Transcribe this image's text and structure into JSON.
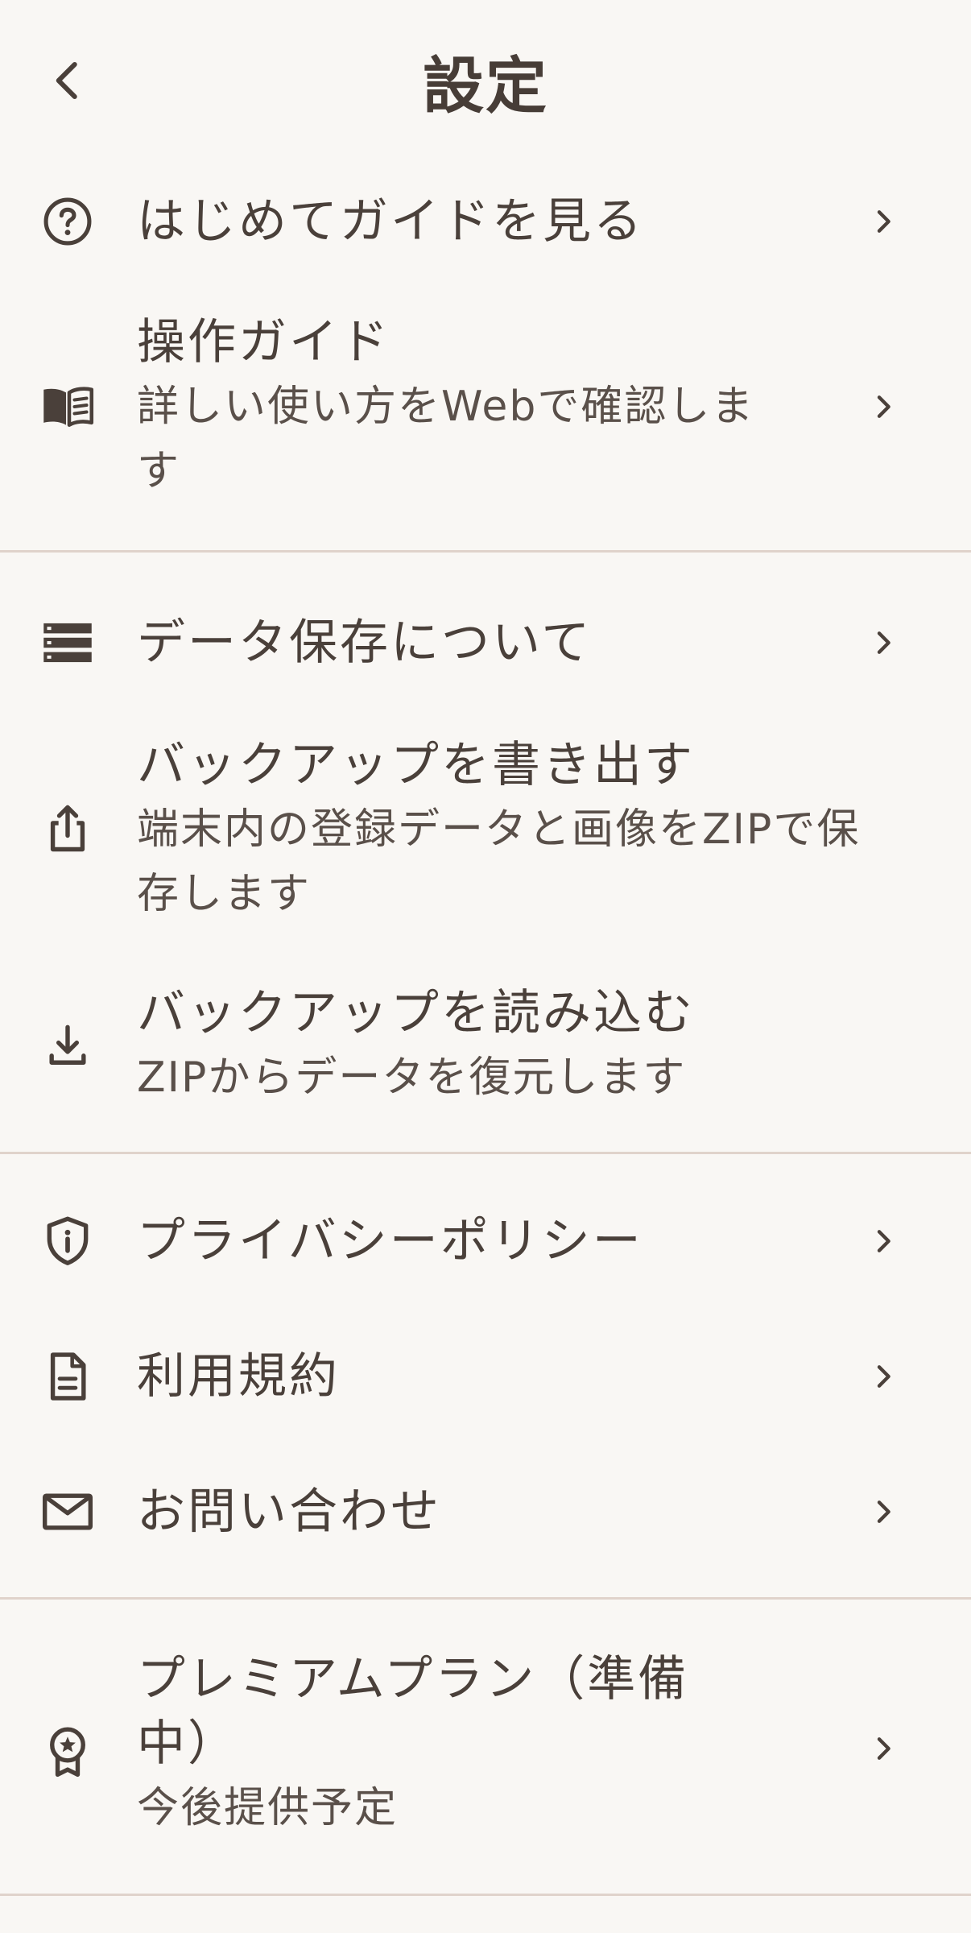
{
  "header": {
    "title": "設定",
    "back_icon": "chevron-left-icon"
  },
  "items": {
    "guide_start": {
      "title": "はじめてガイドを見る",
      "icon": "help-circle-icon"
    },
    "operation_guide": {
      "title": "操作ガイド",
      "subtitle_line1": "詳しい使い方をWebで確認しま",
      "subtitle_line2": "す",
      "icon": "book-open-icon"
    },
    "data_storage": {
      "title": "データ保存について",
      "icon": "storage-icon"
    },
    "export_backup": {
      "title": "バックアップを書き出す",
      "subtitle_line1": "端末内の登録データと画像をZIPで保",
      "subtitle_line2": "存します",
      "icon": "share-upload-icon"
    },
    "import_backup": {
      "title": "バックアップを読み込む",
      "subtitle_line1": "ZIPからデータを復元します",
      "icon": "download-icon"
    },
    "privacy": {
      "title": "プライバシーポリシー",
      "icon": "shield-info-icon"
    },
    "terms": {
      "title": "利用規約",
      "icon": "document-icon"
    },
    "contact": {
      "title": "お問い合わせ",
      "icon": "mail-icon"
    },
    "premium": {
      "title_line1": "プレミアムプラン（準備",
      "title_line2": "中）",
      "subtitle_line1": "今後提供予定",
      "icon": "award-star-icon"
    }
  },
  "colors": {
    "background": "#f9f7f4",
    "text": "#4a403a",
    "divider": "#e0d3cb"
  }
}
